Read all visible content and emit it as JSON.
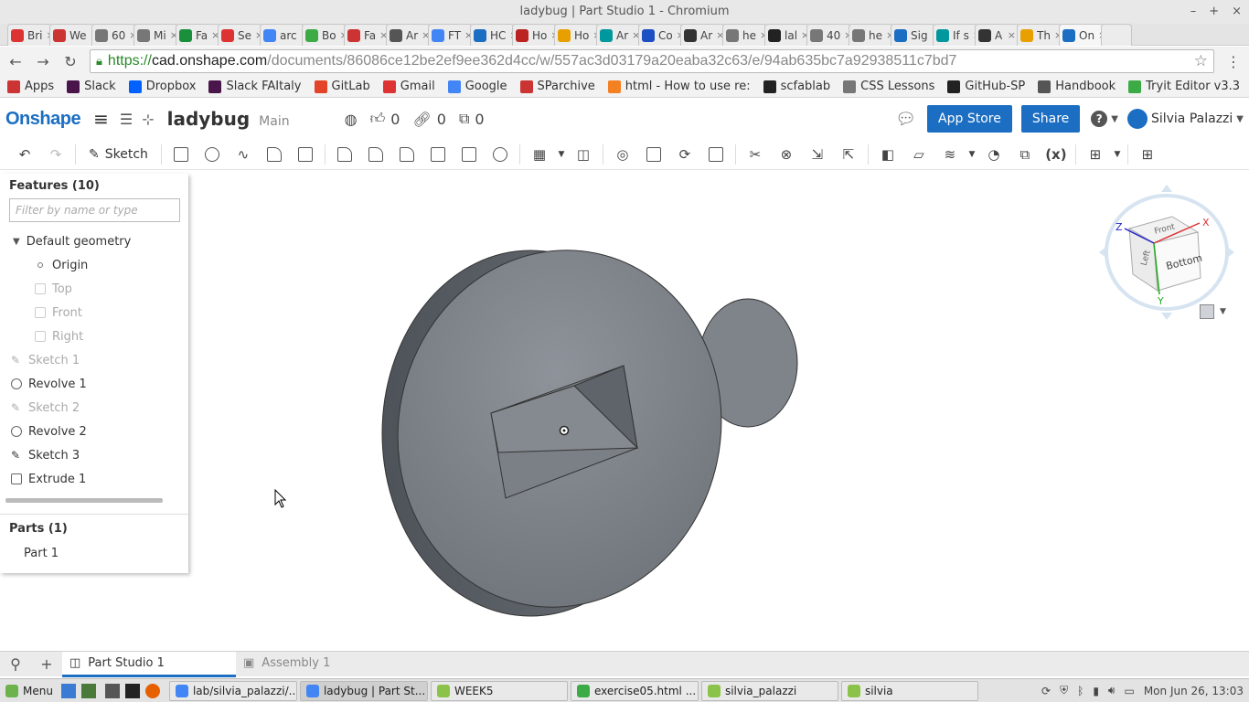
{
  "window": {
    "title": "ladybug | Part Studio 1 - Chromium"
  },
  "browser_tabs": [
    {
      "label": "Bri",
      "color": "#d33"
    },
    {
      "label": "We",
      "color": "#c33"
    },
    {
      "label": "60",
      "color": "#777"
    },
    {
      "label": "Mi",
      "color": "#777"
    },
    {
      "label": "Fa",
      "color": "#1a8f3c"
    },
    {
      "label": "Se",
      "color": "#d33"
    },
    {
      "label": "arc",
      "color": "#4285f4"
    },
    {
      "label": "Bo",
      "color": "#3cab46"
    },
    {
      "label": "Fa",
      "color": "#c33"
    },
    {
      "label": "Ar",
      "color": "#555"
    },
    {
      "label": "FT",
      "color": "#4285f4"
    },
    {
      "label": "HC",
      "color": "#1b6ec2"
    },
    {
      "label": "Ho",
      "color": "#b22"
    },
    {
      "label": "Ho",
      "color": "#e8a000"
    },
    {
      "label": "Ar",
      "color": "#00979d"
    },
    {
      "label": "Co",
      "color": "#1b4fc2"
    },
    {
      "label": "Ar",
      "color": "#333"
    },
    {
      "label": "he",
      "color": "#777"
    },
    {
      "label": "lal",
      "color": "#222"
    },
    {
      "label": "40",
      "color": "#777"
    },
    {
      "label": "he",
      "color": "#777"
    },
    {
      "label": "Sig",
      "color": "#1b6ec2"
    },
    {
      "label": "If s",
      "color": "#00979d"
    },
    {
      "label": "A",
      "color": "#333"
    },
    {
      "label": "Th",
      "color": "#e8a000"
    },
    {
      "label": "On",
      "color": "#1b6ec2"
    }
  ],
  "address": {
    "scheme": "https://",
    "host": "cad.onshape.com",
    "path": "/documents/86086ce12be2ef9ee362d4cc/w/557ac3d03179a20eaba32c63/e/94ab635bc7a92938511c7bd7"
  },
  "bookmarks": [
    {
      "label": "Apps",
      "color": "#c33"
    },
    {
      "label": "Slack",
      "color": "#4a154b"
    },
    {
      "label": "Dropbox",
      "color": "#0061fe"
    },
    {
      "label": "Slack FAItaly",
      "color": "#4a154b"
    },
    {
      "label": "GitLab",
      "color": "#e24329"
    },
    {
      "label": "Gmail",
      "color": "#d33"
    },
    {
      "label": "Google",
      "color": "#4285f4"
    },
    {
      "label": "SParchive",
      "color": "#c33"
    },
    {
      "label": "html - How to use re:",
      "color": "#f48024"
    },
    {
      "label": "scfablab",
      "color": "#222"
    },
    {
      "label": "CSS Lessons",
      "color": "#777"
    },
    {
      "label": "GitHub-SP",
      "color": "#222"
    },
    {
      "label": "Handbook",
      "color": "#555"
    },
    {
      "label": "Tryit Editor v3.3",
      "color": "#3cab46"
    }
  ],
  "appbar": {
    "logo": "Onshape",
    "doc_name": "ladybug",
    "branch": "Main",
    "likes": "0",
    "links": "0",
    "copies": "0",
    "app_store": "App Store",
    "share": "Share",
    "help": "?",
    "user": "Silvia Palazzi"
  },
  "toolbar": {
    "sketch_label": "Sketch"
  },
  "features": {
    "header": "Features (10)",
    "filter_placeholder": "Filter by name or type",
    "group": "Default geometry",
    "items": [
      {
        "label": "Origin",
        "kind": "origin",
        "dim": false
      },
      {
        "label": "Top",
        "kind": "plane",
        "dim": true
      },
      {
        "label": "Front",
        "kind": "plane",
        "dim": true
      },
      {
        "label": "Right",
        "kind": "plane",
        "dim": true
      },
      {
        "label": "Sketch 1",
        "kind": "sketch",
        "dim": true
      },
      {
        "label": "Revolve 1",
        "kind": "revolve",
        "dim": false
      },
      {
        "label": "Sketch 2",
        "kind": "sketch",
        "dim": true
      },
      {
        "label": "Revolve 2",
        "kind": "revolve",
        "dim": false
      },
      {
        "label": "Sketch 3",
        "kind": "sketch",
        "dim": false
      },
      {
        "label": "Extrude 1",
        "kind": "extrude",
        "dim": false
      }
    ]
  },
  "parts": {
    "header": "Parts (1)",
    "items": [
      "Part 1"
    ]
  },
  "view_cube": {
    "front": "Front",
    "left": "Left",
    "bottom": "Bottom",
    "x": "X",
    "y": "Y",
    "z": "Z"
  },
  "bottom_tabs": [
    {
      "label": "Part Studio 1",
      "active": true
    },
    {
      "label": "Assembly 1",
      "active": false
    }
  ],
  "taskbar": {
    "menu": "Menu",
    "items": [
      {
        "label": "lab/silvia_palazzi/...",
        "color": "#4285f4",
        "active": false
      },
      {
        "label": "ladybug | Part St...",
        "color": "#4285f4",
        "active": true
      },
      {
        "label": "WEEK5",
        "color": "#8bc34a",
        "active": false
      },
      {
        "label": "exercise05.html ...",
        "color": "#3cab46",
        "active": false
      },
      {
        "label": "silvia_palazzi",
        "color": "#8bc34a",
        "active": false
      },
      {
        "label": "silvia",
        "color": "#8bc34a",
        "active": false
      }
    ],
    "clock": "Mon Jun 26, 13:03"
  },
  "colors": {
    "brand": "#1b6ec2",
    "model_face": "#7e8389",
    "model_edge": "#333333"
  }
}
